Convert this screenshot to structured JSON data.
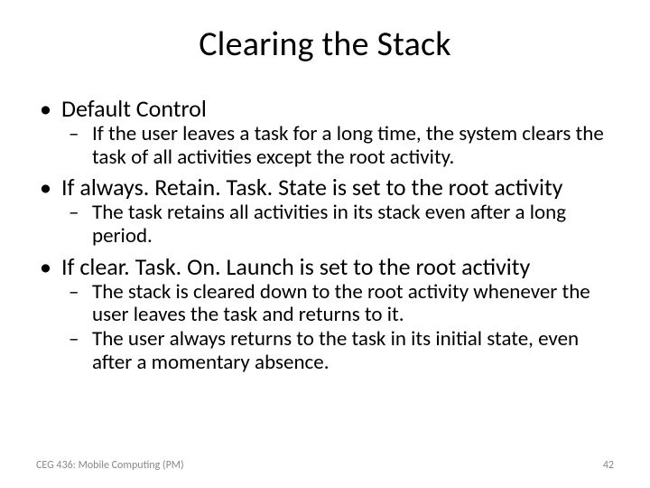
{
  "title": "Clearing the Stack",
  "bullets": [
    {
      "text": "Default Control",
      "sub": [
        "If the user leaves a task for a long time, the system clears the task of all activities except the root activity."
      ]
    },
    {
      "text": "If always. Retain. Task. State is set to the root activity",
      "sub": [
        "The task retains all activities in its stack even after a long period."
      ]
    },
    {
      "text": "If clear. Task. On. Launch is set to the root activity",
      "sub": [
        "The stack is cleared down to the root activity whenever the user leaves the task and returns to it.",
        "The user always returns to the task in its initial state, even after a momentary absence."
      ]
    }
  ],
  "footer": {
    "left": "CEG 436: Mobile Computing (PM)",
    "right": "42"
  }
}
